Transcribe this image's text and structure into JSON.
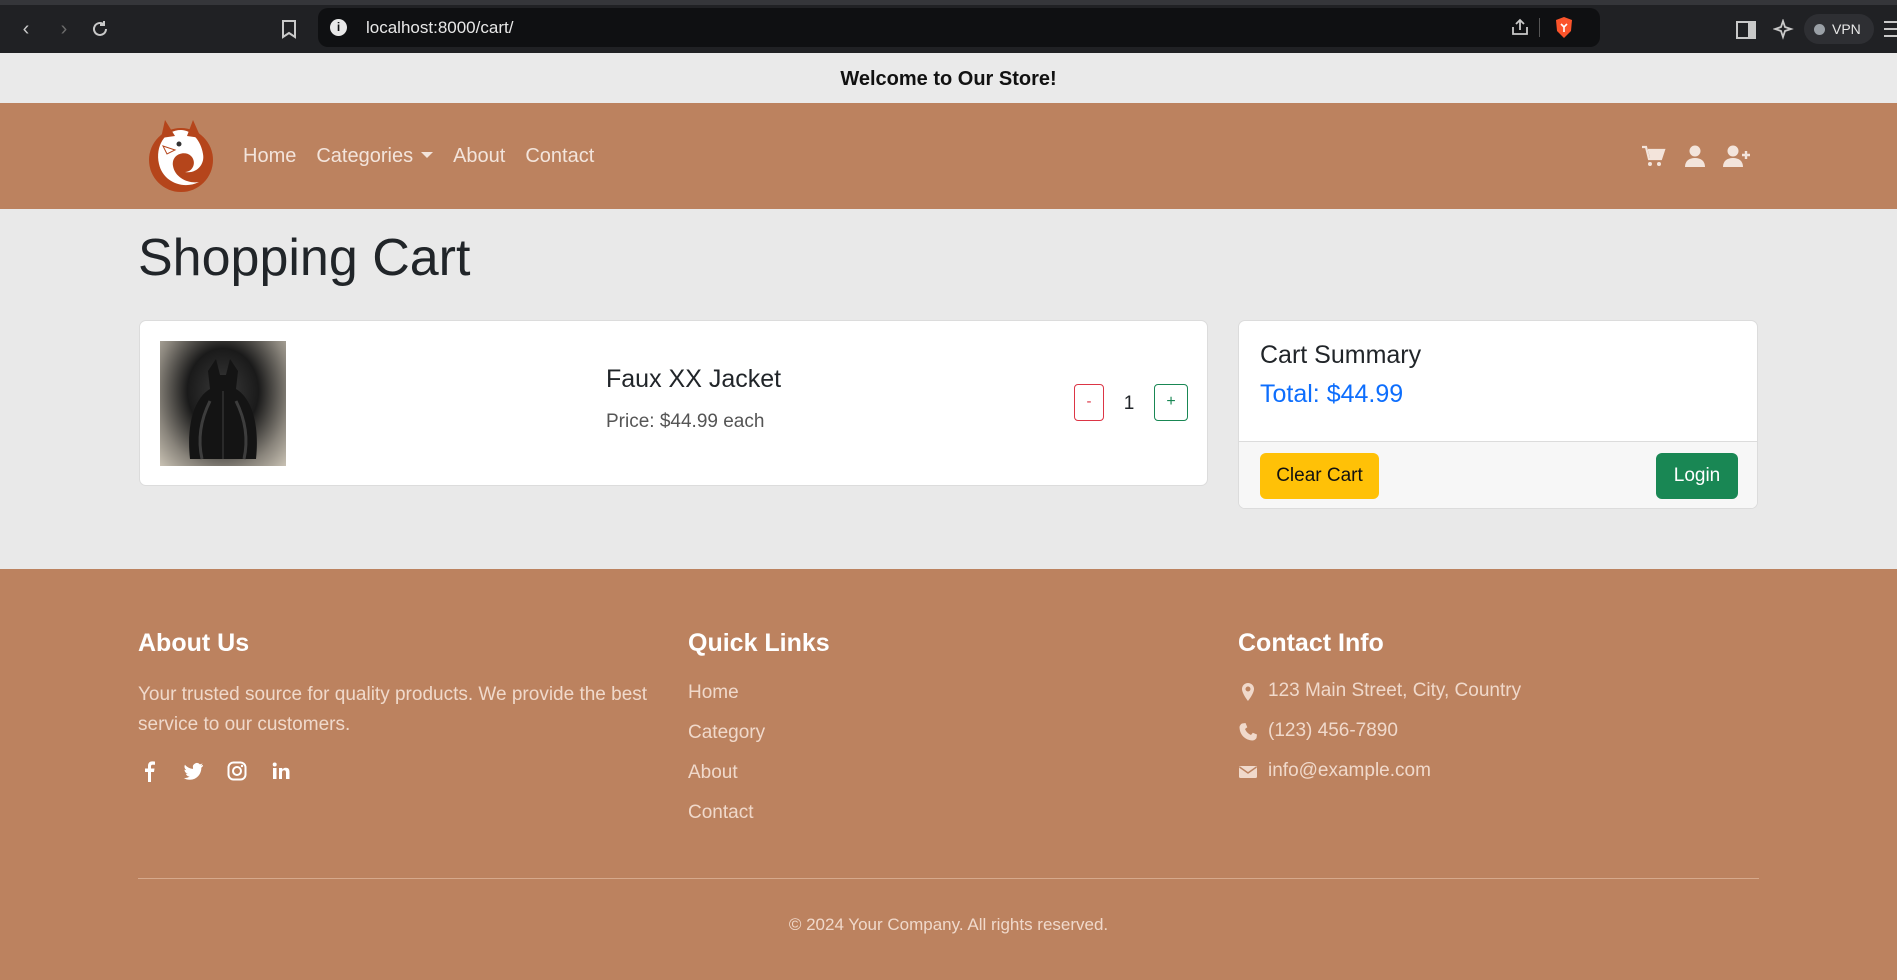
{
  "browser": {
    "url": "localhost:8000/cart/",
    "vpn_label": "VPN"
  },
  "banner": {
    "text": "Welcome to Our Store!"
  },
  "nav": {
    "links": [
      "Home",
      "Categories",
      "About",
      "Contact"
    ],
    "icons": [
      "cart-icon",
      "user-icon",
      "user-plus-icon"
    ]
  },
  "page": {
    "title": "Shopping Cart"
  },
  "cart": {
    "items": [
      {
        "name": "Faux XX Jacket",
        "price_text": "Price: $44.99 each",
        "quantity": "1",
        "minus": "-",
        "plus": "+"
      }
    ]
  },
  "summary": {
    "title": "Cart Summary",
    "total": "Total: $44.99",
    "clear_label": "Clear Cart",
    "login_label": "Login"
  },
  "footer": {
    "about": {
      "heading": "About Us",
      "text": "Your trusted source for quality products. We provide the best service to our customers.",
      "social": [
        "facebook-icon",
        "twitter-icon",
        "instagram-icon",
        "linkedin-icon"
      ]
    },
    "quick_links": {
      "heading": "Quick Links",
      "links": [
        "Home",
        "Category",
        "About",
        "Contact"
      ]
    },
    "contact": {
      "heading": "Contact Info",
      "address": "123 Main Street, City, Country",
      "phone": "(123) 456-7890",
      "email": "info@example.com"
    },
    "copyright": "© 2024 Your Company. All rights reserved."
  },
  "colors": {
    "brand": "#bc825f",
    "primary": "#0d6efd",
    "success": "#198754",
    "warning": "#ffc107",
    "danger": "#dc3545"
  }
}
